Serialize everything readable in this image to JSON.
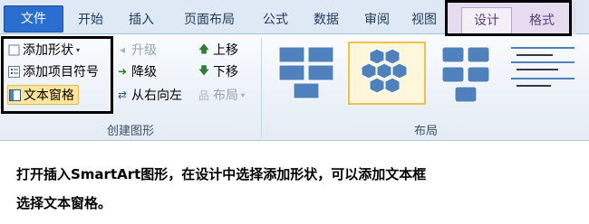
{
  "tabs": {
    "file": "文件",
    "home": "开始",
    "insert": "插入",
    "page_layout": "页面布局",
    "formulas": "公式",
    "data": "数据",
    "review": "审阅",
    "view": "视图",
    "design": "设计",
    "format": "格式"
  },
  "create_graphic": {
    "add_shape": "添加形状",
    "add_bullet": "添加项目符号",
    "text_pane": "文本窗格",
    "promote": "升级",
    "demote": "降级",
    "right_to_left": "从右向左",
    "move_up": "上移",
    "move_down": "下移",
    "layout": "布局",
    "group_label": "创建图形"
  },
  "layouts": {
    "group_label": "布局"
  },
  "caption": {
    "line1": "打开插入SmartArt图形，在设计中选择添加形状，可以添加文本框",
    "line2": "选择文本窗格。"
  },
  "colors": {
    "accent": "#4f81bd",
    "highlight_box": "#000000",
    "file_tab": "#2a6fcf",
    "selection": "#fde59a"
  }
}
